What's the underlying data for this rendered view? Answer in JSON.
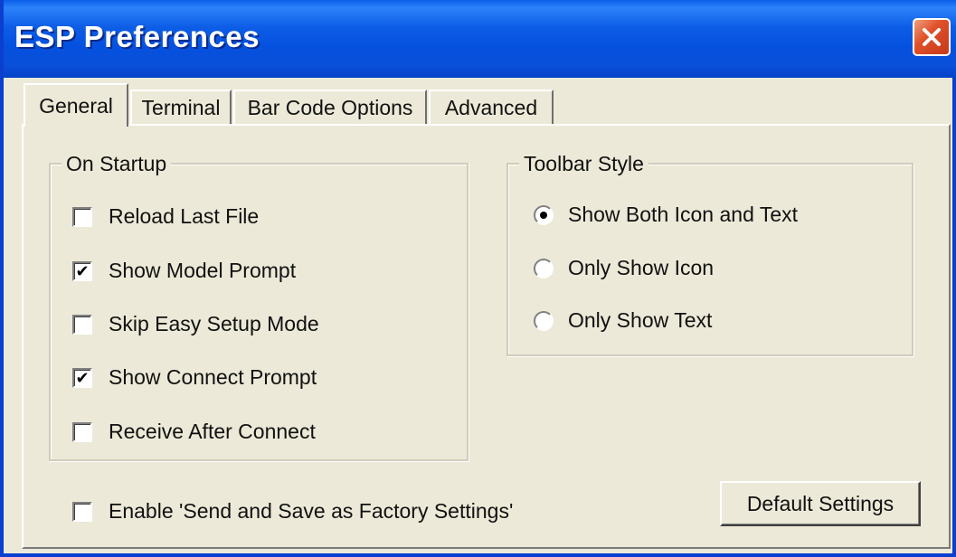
{
  "window": {
    "title": "ESP Preferences",
    "close_icon": "close-icon",
    "close_color": "#e0512a",
    "titlebar_color": "#0a5fe8"
  },
  "tabs": [
    {
      "label": "General",
      "active": true
    },
    {
      "label": "Terminal",
      "active": false
    },
    {
      "label": "Bar Code Options",
      "active": false
    },
    {
      "label": "Advanced",
      "active": false
    }
  ],
  "on_startup": {
    "label": "On Startup",
    "options": [
      {
        "label": "Reload Last File",
        "checked": false
      },
      {
        "label": "Show Model Prompt",
        "checked": true
      },
      {
        "label": "Skip Easy Setup Mode",
        "checked": false
      },
      {
        "label": "Show Connect Prompt",
        "checked": true
      },
      {
        "label": "Receive After Connect",
        "checked": false
      }
    ]
  },
  "toolbar_style": {
    "label": "Toolbar Style",
    "options": [
      {
        "label": "Show Both Icon and Text",
        "selected": true
      },
      {
        "label": "Only Show Icon",
        "selected": false
      },
      {
        "label": "Only Show Text",
        "selected": false
      }
    ]
  },
  "factory": {
    "label": "Enable 'Send and Save as Factory Settings'",
    "checked": false
  },
  "default_button": {
    "label": "Default Settings"
  }
}
